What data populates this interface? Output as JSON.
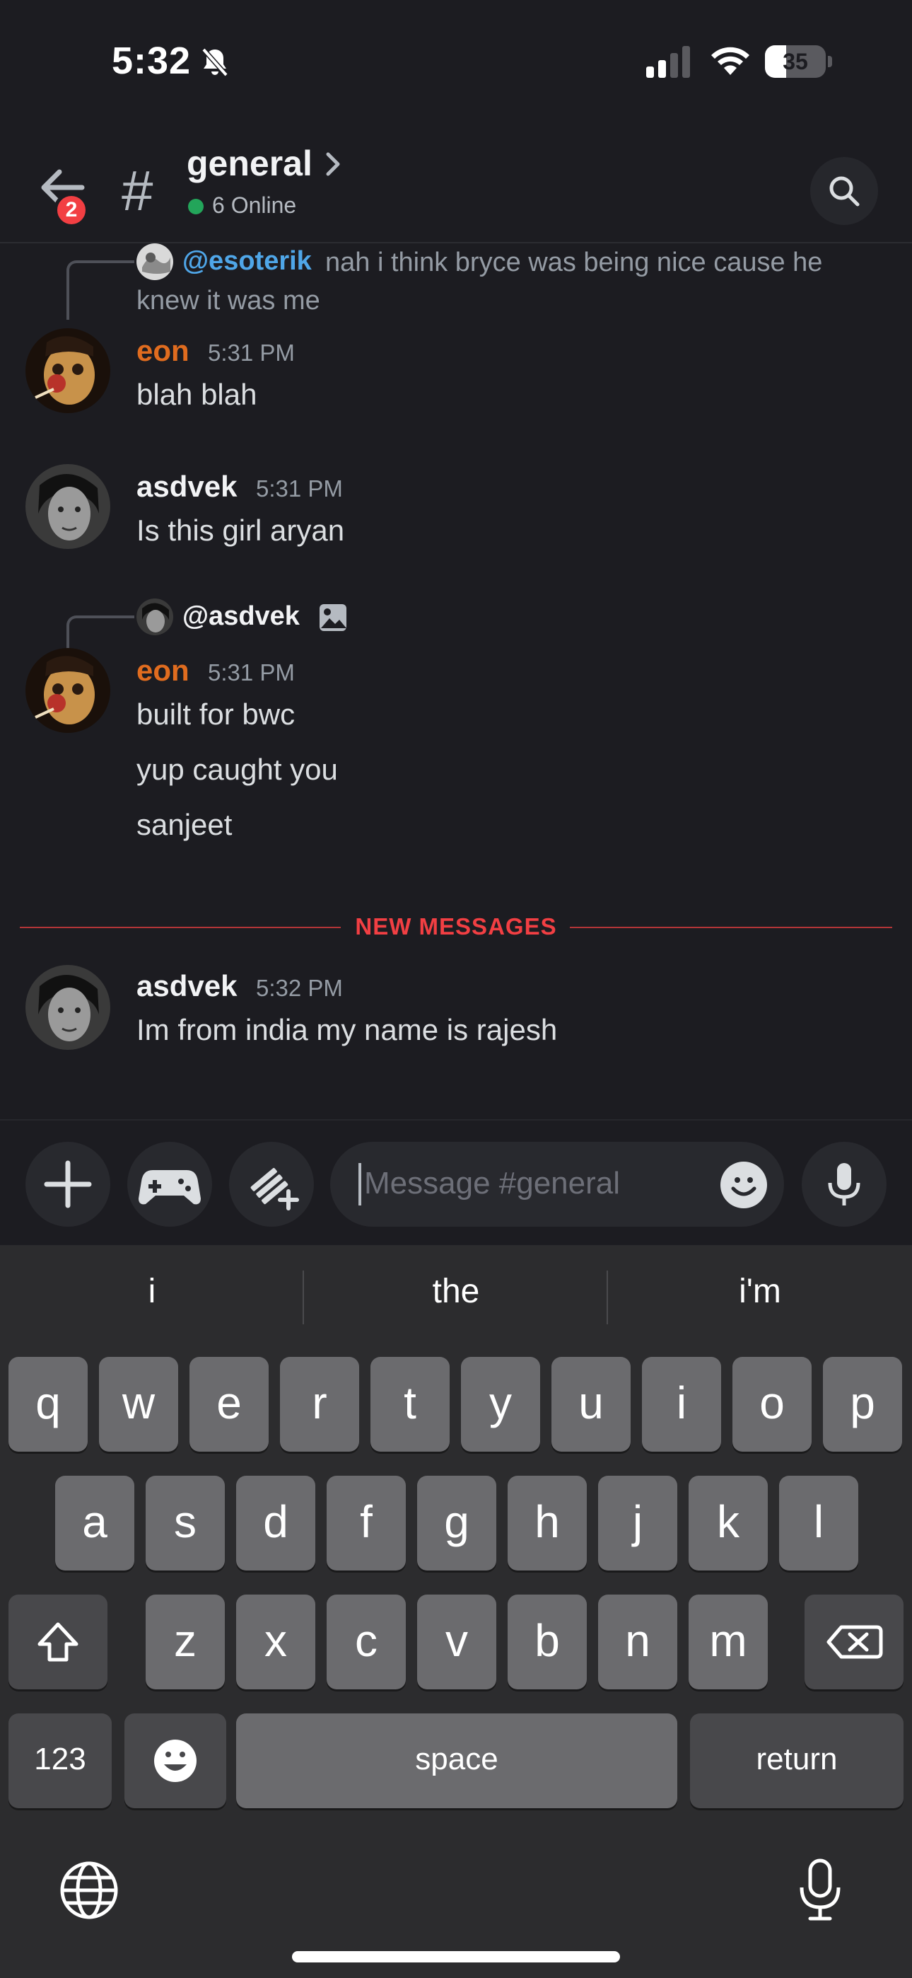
{
  "status_bar": {
    "time": "5:32",
    "battery_level": "35",
    "icons": [
      "bell-slash-icon",
      "cellular-signal-icon",
      "wifi-icon",
      "battery-icon"
    ]
  },
  "header": {
    "back_badge": "2",
    "channel_name": "general",
    "online_status": "6 Online",
    "icons": [
      "back-arrow-icon",
      "hash-icon",
      "chevron-right-icon",
      "search-icon"
    ]
  },
  "messages": [
    {
      "reply": {
        "mention": "@esoterik",
        "text": "nah i think bryce was being nice cause he",
        "text_cont": "knew it was me"
      },
      "author": "eon",
      "timestamp": "5:31 PM",
      "lines": [
        "blah blah"
      ]
    },
    {
      "author": "asdvek",
      "timestamp": "5:31 PM",
      "lines": [
        "Is this girl aryan"
      ]
    },
    {
      "reply": {
        "mention": "@asdvek",
        "attachment_icon": "image-icon"
      },
      "author": "eon",
      "timestamp": "5:31 PM",
      "lines": [
        "built for bwc",
        "yup caught you",
        "sanjeet"
      ]
    },
    {
      "author": "asdvek",
      "timestamp": "5:32 PM",
      "lines": [
        "Im from india my name is rajesh"
      ]
    }
  ],
  "new_messages_label": "NEW MESSAGES",
  "composer": {
    "placeholder": "Message #general",
    "icons": [
      "plus-icon",
      "gamepad-icon",
      "gift-icon",
      "emoji-icon",
      "microphone-icon"
    ]
  },
  "keyboard": {
    "suggestions": [
      "i",
      "the",
      "i'm"
    ],
    "row1": [
      "q",
      "w",
      "e",
      "r",
      "t",
      "y",
      "u",
      "i",
      "o",
      "p"
    ],
    "row2": [
      "a",
      "s",
      "d",
      "f",
      "g",
      "h",
      "j",
      "k",
      "l"
    ],
    "row3": [
      "z",
      "x",
      "c",
      "v",
      "b",
      "n",
      "m"
    ],
    "numbers_key": "123",
    "space_key": "space",
    "return_key": "return",
    "icons": [
      "shift-icon",
      "backspace-icon",
      "emoji-key-icon",
      "globe-icon",
      "dictation-icon"
    ]
  },
  "colors": {
    "background": "#1c1c21",
    "eon_name": "#e06c1f",
    "asdvek_name": "#f2f3f5",
    "mention": "#4fa6e8",
    "new_messages": "#f23f43",
    "online": "#23a55a"
  }
}
